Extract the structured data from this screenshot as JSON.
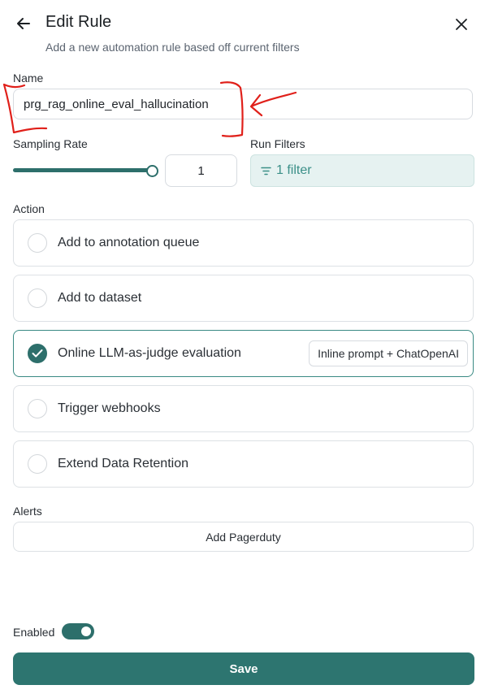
{
  "header": {
    "title": "Edit Rule",
    "subtitle": "Add a new automation rule based off current filters"
  },
  "name_section": {
    "label": "Name",
    "value": "prg_rag_online_eval_hallucination"
  },
  "sampling": {
    "label": "Sampling Rate",
    "value": "1",
    "slider_fraction": 1.0
  },
  "run_filters": {
    "label": "Run Filters",
    "button_label": "1 filter"
  },
  "action_section": {
    "label": "Action",
    "options": [
      {
        "label": "Add to annotation queue",
        "selected": false
      },
      {
        "label": "Add to dataset",
        "selected": false
      },
      {
        "label": "Online LLM-as-judge evaluation",
        "selected": true,
        "badge": "Inline prompt + ChatOpenAI"
      },
      {
        "label": "Trigger webhooks",
        "selected": false
      },
      {
        "label": "Extend Data Retention",
        "selected": false
      }
    ]
  },
  "alerts": {
    "label": "Alerts",
    "button_label": "Add Pagerduty"
  },
  "enabled": {
    "label": "Enabled",
    "on": true
  },
  "save_label": "Save",
  "colors": {
    "accent": "#2d6f6b",
    "filter_bg": "#e6f2f1",
    "filter_text": "#3b8f88",
    "annotation_red": "#e0201a"
  },
  "icons": {
    "back": "arrow-left-icon",
    "close": "close-icon",
    "filter": "filter-icon",
    "check": "check-icon"
  }
}
